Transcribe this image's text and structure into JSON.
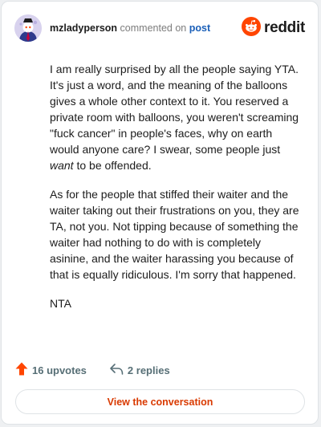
{
  "header": {
    "username": "mzladyperson",
    "action_text": "commented on",
    "post_link": "post",
    "brand": "reddit"
  },
  "comment": {
    "p1_before": "I am really surprised by all the people saying YTA. It's just a word, and the meaning of the balloons gives a whole other context to it. You reserved a private room with balloons, you weren't screaming \"fuck cancer\" in people's faces, why on earth would anyone care? I swear, some people just ",
    "p1_emph": "want",
    "p1_after": " to be offended.",
    "p2": "As for the people that stiffed their waiter and the waiter taking out their frustrations on you, they are TA, not you. Not tipping because of something the waiter had nothing to do with is completely asinine, and the waiter harassing you because of that is equally ridiculous. I'm sorry that happened.",
    "p3": "NTA"
  },
  "actions": {
    "upvotes": "16 upvotes",
    "replies": "2 replies",
    "upvote_icon": "upvote-arrow-icon",
    "reply_icon": "reply-arrow-icon"
  },
  "footer": {
    "view_button": "View the conversation"
  },
  "colors": {
    "accent": "#d93a00",
    "brand_orange": "#ff4500",
    "link": "#1a5fb8",
    "muted": "#576f76"
  }
}
